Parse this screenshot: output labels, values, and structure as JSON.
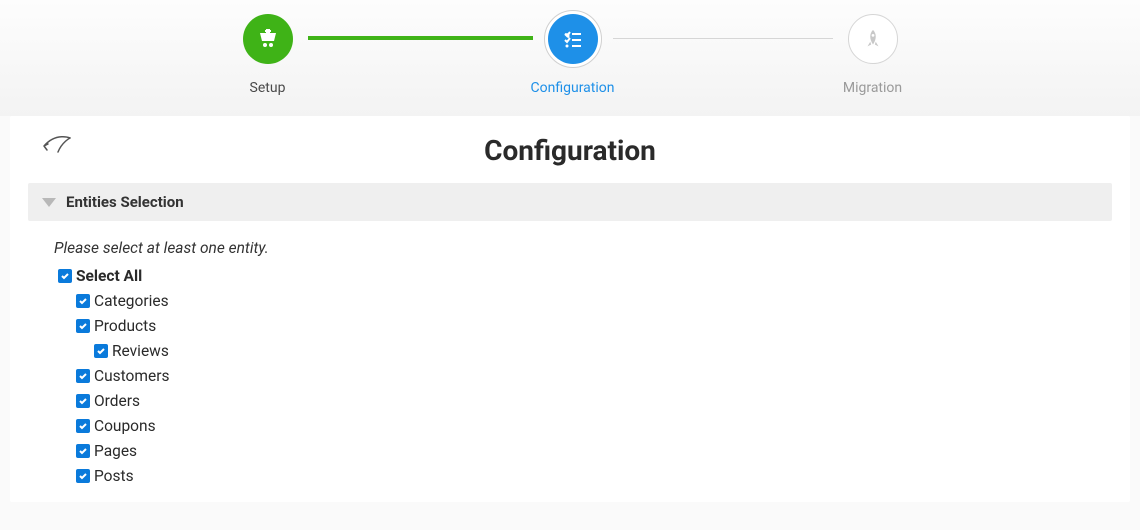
{
  "stepper": {
    "s1": {
      "label": "Setup"
    },
    "s2": {
      "label": "Configuration"
    },
    "s3": {
      "label": "Migration"
    }
  },
  "page": {
    "title": "Configuration"
  },
  "section": {
    "title": "Entities Selection",
    "hint": "Please select at least one entity."
  },
  "entities": {
    "selectAll": "Select All",
    "categories": "Categories",
    "products": "Products",
    "reviews": "Reviews",
    "customers": "Customers",
    "orders": "Orders",
    "coupons": "Coupons",
    "pages": "Pages",
    "posts": "Posts"
  }
}
